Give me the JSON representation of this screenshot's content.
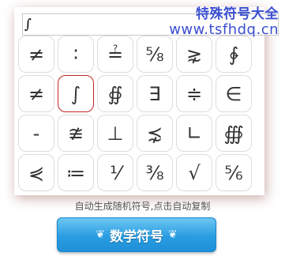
{
  "watermark": {
    "line1": "特殊符号大全",
    "line2": "www.tsfhdq.cn",
    "color": "#3b4fd0"
  },
  "search": {
    "value": "∫"
  },
  "symbols": [
    [
      "≠",
      "∶",
      "≟",
      "⅝",
      "⋧",
      "∲"
    ],
    [
      "≠",
      "∫",
      "∯",
      "∃",
      "≑",
      "∈"
    ],
    [
      "-",
      "≇",
      "⊥",
      "⋨",
      "∟",
      "∰"
    ],
    [
      "⋞",
      "≔",
      "⅟",
      "⅜",
      "√",
      "⅚"
    ]
  ],
  "selected_symbol": "∫",
  "caption": "自动生成随机符号,点击自动复制",
  "button": {
    "label": "数学符号",
    "ornament_left": "❦",
    "ornament_right": "❦",
    "color": "#2a9de2"
  },
  "accent_color": "#c42727"
}
